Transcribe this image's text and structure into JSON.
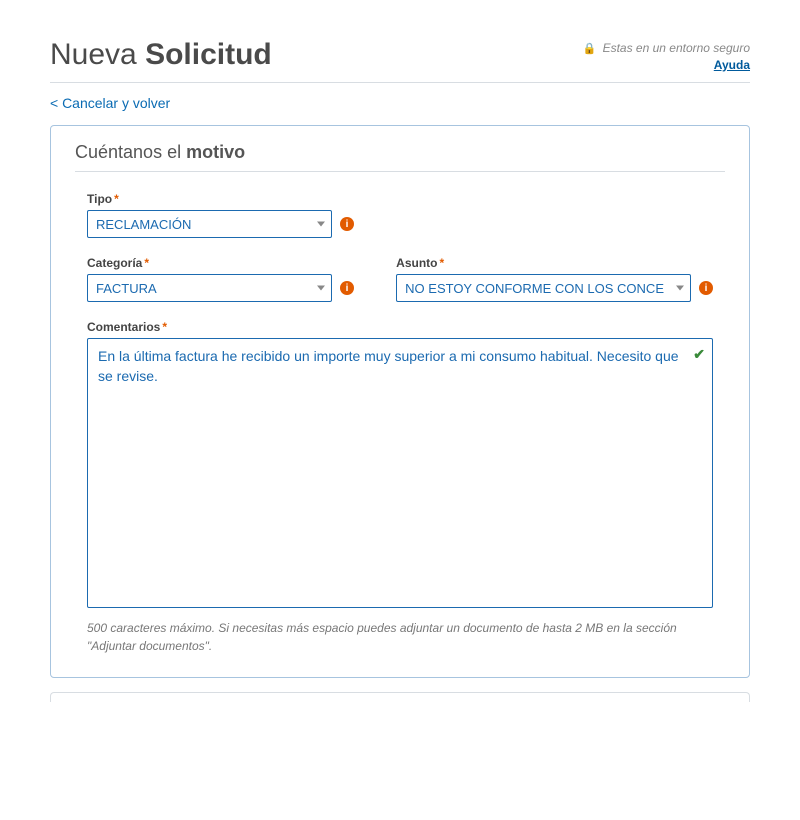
{
  "header": {
    "title_light": "Nueva ",
    "title_bold": "Solicitud",
    "secure_text": "Estas en un entorno seguro",
    "help_label": "Ayuda"
  },
  "nav": {
    "cancel_label": "< Cancelar y volver"
  },
  "panel": {
    "title_light": "Cuéntanos el ",
    "title_bold": "motivo",
    "fields": {
      "tipo": {
        "label": "Tipo",
        "value": "RECLAMACIÓN"
      },
      "categoria": {
        "label": "Categoría",
        "value": "FACTURA"
      },
      "asunto": {
        "label": "Asunto",
        "value": "NO ESTOY CONFORME CON LOS CONCE"
      },
      "comentarios": {
        "label": "Comentarios",
        "value": "En la última factura he recibido un importe muy superior a mi consumo habitual. Necesito que se revise.",
        "hint": "500 caracteres máximo. Si necesitas más espacio puedes adjuntar un documento de hasta 2 MB en la sección \"Adjuntar documentos\"."
      }
    }
  },
  "icons": {
    "info": "i",
    "lock": "🔒",
    "check": "✔"
  }
}
